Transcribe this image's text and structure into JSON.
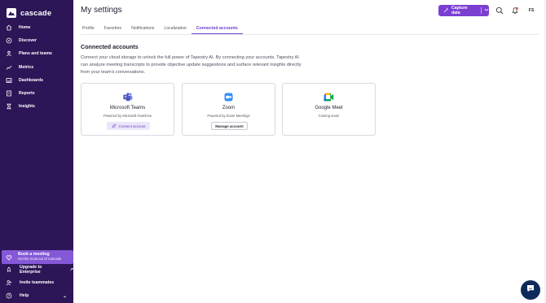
{
  "app": {
    "name": "cascade"
  },
  "sidebar": {
    "items": [
      {
        "label": "Home",
        "icon": "home-icon"
      },
      {
        "label": "Discover",
        "icon": "compass-icon"
      },
      {
        "label": "Plans and teams",
        "icon": "plans-icon"
      },
      {
        "label": "Metrics",
        "icon": "metrics-icon"
      },
      {
        "label": "Dashboards",
        "icon": "dashboard-icon"
      },
      {
        "label": "Reports",
        "icon": "reports-icon"
      },
      {
        "label": "Insights",
        "icon": "insights-icon"
      }
    ],
    "book": {
      "title": "Book a meeting",
      "subtitle": "Get the most out of Cascade"
    },
    "upgrade": {
      "label": "Upgrade to Enterprise"
    },
    "invite": {
      "label": "Invite teammates"
    },
    "help": {
      "label": "Help"
    }
  },
  "header": {
    "title": "My settings",
    "capture_label": "Capture data",
    "avatar_initials": "FS"
  },
  "tabs": [
    {
      "label": "Profile",
      "active": false
    },
    {
      "label": "Favorites",
      "active": false
    },
    {
      "label": "Notifications",
      "active": false
    },
    {
      "label": "Localization",
      "active": false
    },
    {
      "label": "Connected accounts",
      "active": true
    }
  ],
  "section": {
    "title": "Connected accounts",
    "description": "Connect your cloud storage to unlock the full power of Tapestry AI. By connecting your accounts, Tapestry AI can analyze meeting transcripts to provide objective update suggestions and surface relevant insights directly from your team's conversations."
  },
  "cards": [
    {
      "name": "Microsoft Teams",
      "subtitle": "Powered by Microsoft OneDrive",
      "button": "Connect account",
      "icon": "microsoft-teams-icon"
    },
    {
      "name": "Zoom",
      "subtitle": "Powered by Zoom Meetings",
      "button": "Manage account",
      "icon": "zoom-icon"
    },
    {
      "name": "Google Meet",
      "subtitle": "Coming soon!",
      "icon": "google-meet-icon"
    }
  ],
  "colors": {
    "sidebar_bg": "#2c1657",
    "accent": "#7b3fd2",
    "book_bg": "#8458d6",
    "fab_bg": "#0e2a5a"
  }
}
